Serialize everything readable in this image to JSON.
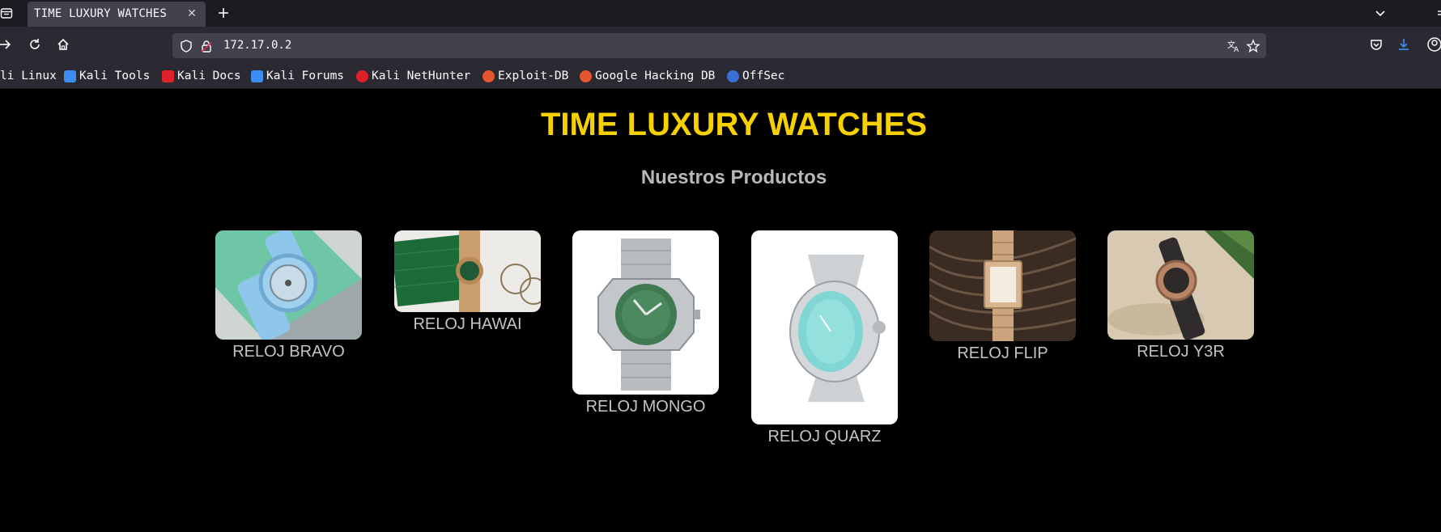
{
  "browser": {
    "tab": {
      "title": "TIME LUXURY WATCHES"
    },
    "url": "172.17.0.2",
    "bookmarks": [
      {
        "label": "li Linux",
        "icon": "kali-icon",
        "color": "#367bf0"
      },
      {
        "label": "Kali Tools",
        "icon": "kali-tools-icon",
        "color": "#3c8ef5"
      },
      {
        "label": "Kali Docs",
        "icon": "kali-docs-icon",
        "color": "#e0202a"
      },
      {
        "label": "Kali Forums",
        "icon": "kali-forums-icon",
        "color": "#3c8ef5"
      },
      {
        "label": "Kali NetHunter",
        "icon": "nethunter-icon",
        "color": "#e0202a"
      },
      {
        "label": "Exploit-DB",
        "icon": "exploitdb-icon",
        "color": "#e4572e"
      },
      {
        "label": "Google Hacking DB",
        "icon": "ghdb-icon",
        "color": "#e4572e"
      },
      {
        "label": "OffSec",
        "icon": "offsec-icon",
        "color": "#3a6fd8"
      }
    ]
  },
  "site": {
    "title": "TIME LUXURY WATCHES",
    "section_title": "Nuestros Productos",
    "accent_color": "#f6d000",
    "products": [
      {
        "name": "RELOJ BRAVO"
      },
      {
        "name": "RELOJ HAWAI"
      },
      {
        "name": "RELOJ MONGO"
      },
      {
        "name": "RELOJ QUARZ"
      },
      {
        "name": "RELOJ FLIP"
      },
      {
        "name": "RELOJ Y3R"
      }
    ]
  }
}
